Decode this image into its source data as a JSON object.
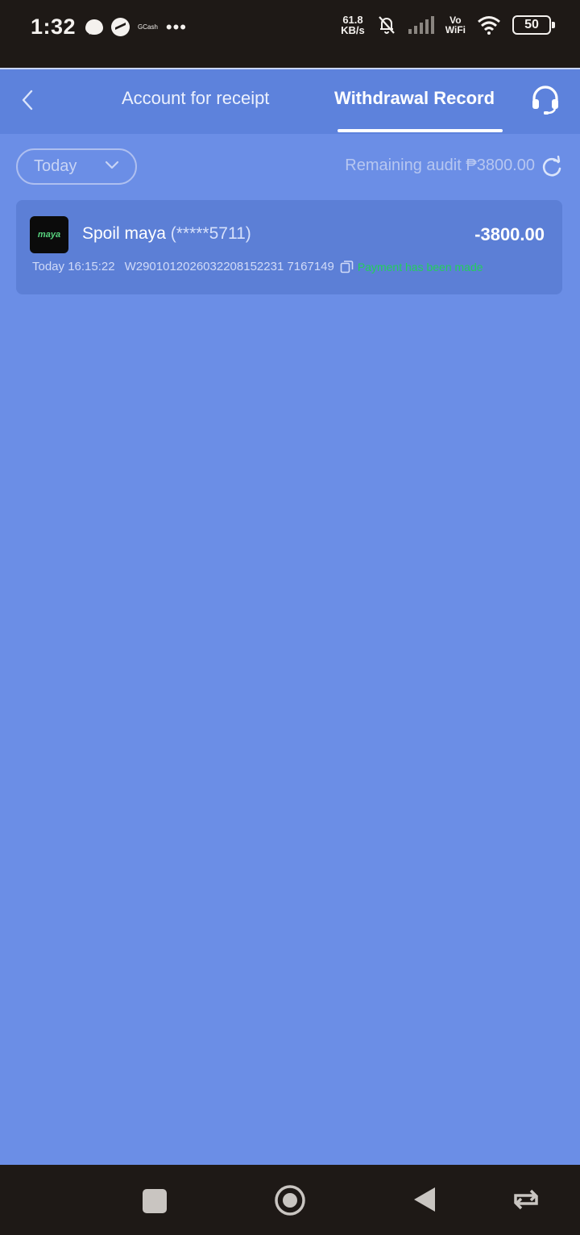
{
  "status_bar": {
    "time": "1:32",
    "gcash_label": "GCash",
    "dots": "•••",
    "net_speed_value": "61.8",
    "net_speed_unit": "KB/s",
    "vo_label": "Vo",
    "wifi_label": "WiFi",
    "battery": "50"
  },
  "header": {
    "tab_account": "Account for receipt",
    "tab_withdrawal": "Withdrawal Record",
    "active_tab": "Withdrawal Record"
  },
  "filter": {
    "date_value": "Today",
    "remaining_audit": "Remaining audit ₱3800.00"
  },
  "records": [
    {
      "logo_text": "maya",
      "wallet_name": "Spoil maya",
      "masked_account": "(*****5711)",
      "amount": "-3800.00",
      "time": "Today 16:15:22",
      "order_id": "W2901012026032208152231 7167149",
      "status": "Payment has been made"
    }
  ],
  "colors": {
    "background": "#6b8ee6",
    "header": "#5d82dc",
    "card": "#5c7fd6",
    "status_success": "#23cf5a",
    "system_bar": "#1e1916"
  }
}
